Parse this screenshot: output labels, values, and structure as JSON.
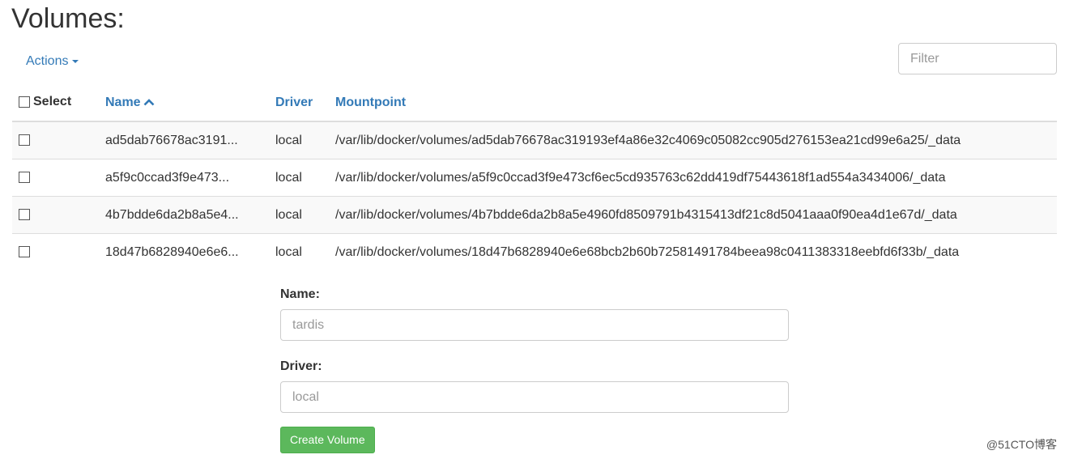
{
  "page": {
    "title": "Volumes:"
  },
  "toolbar": {
    "actions_label": "Actions",
    "filter_placeholder": "Filter"
  },
  "table": {
    "headers": {
      "select": "Select",
      "name": "Name",
      "driver": "Driver",
      "mountpoint": "Mountpoint"
    },
    "sort": {
      "column": "Name",
      "direction": "ascending",
      "icon": "chevron-up-icon"
    },
    "rows": [
      {
        "name": "ad5dab76678ac3191...",
        "driver": "local",
        "mountpoint": "/var/lib/docker/volumes/ad5dab76678ac319193ef4a86e32c4069c05082cc905d276153ea21cd99e6a25/_data"
      },
      {
        "name": "a5f9c0ccad3f9e473...",
        "driver": "local",
        "mountpoint": "/var/lib/docker/volumes/a5f9c0ccad3f9e473cf6ec5cd935763c62dd419df75443618f1ad554a3434006/_data"
      },
      {
        "name": "4b7bdde6da2b8a5e4...",
        "driver": "local",
        "mountpoint": "/var/lib/docker/volumes/4b7bdde6da2b8a5e4960fd8509791b4315413df21c8d5041aaa0f90ea4d1e67d/_data"
      },
      {
        "name": "18d47b6828940e6e6...",
        "driver": "local",
        "mountpoint": "/var/lib/docker/volumes/18d47b6828940e6e68bcb2b60b72581491784beea98c0411383318eebfd6f33b/_data"
      }
    ]
  },
  "form": {
    "name_label": "Name:",
    "name_placeholder": "tardis",
    "driver_label": "Driver:",
    "driver_placeholder": "local",
    "create_button": "Create Volume"
  },
  "watermark": "@51CTO博客",
  "colors": {
    "link": "#337ab7",
    "success": "#5cb85c",
    "stripe": "#f9f9f9",
    "border": "#dddddd"
  }
}
